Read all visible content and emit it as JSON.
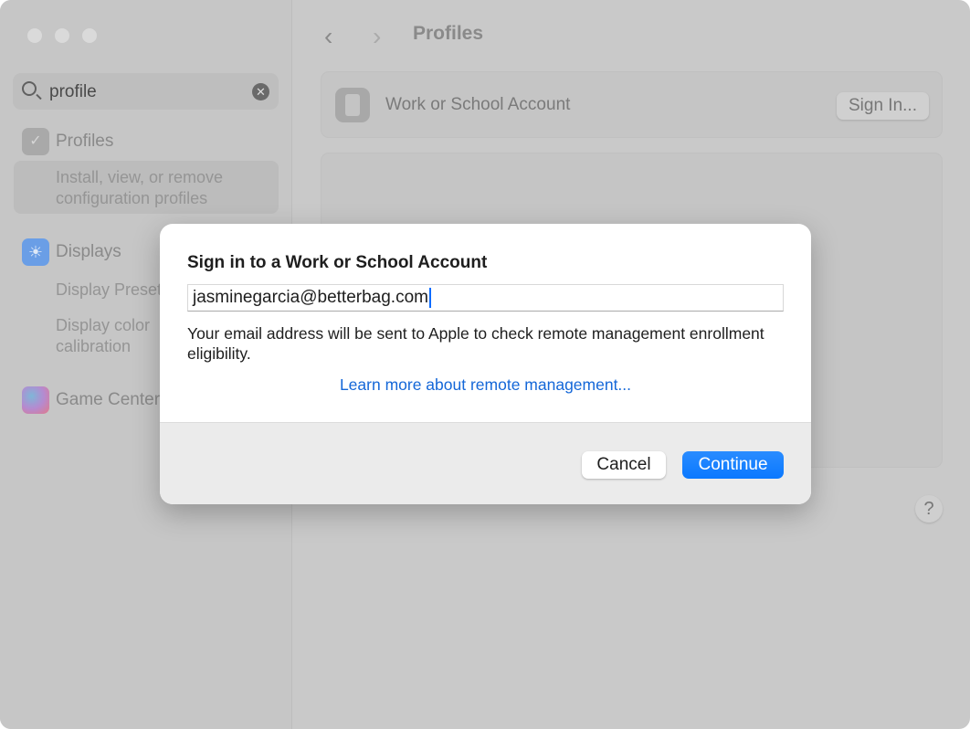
{
  "sidebar": {
    "search": {
      "value": "profile",
      "clear_icon": "xmark-circle-icon"
    },
    "profiles": {
      "title": "Profiles",
      "sub": "Install, view, or remove configuration profiles",
      "icon": "checkmark-seal-icon"
    },
    "displays": {
      "title": "Displays",
      "items": [
        "Display Presets",
        "Display color calibration"
      ],
      "icon": "sun-icon",
      "color": "#6a9ee6"
    },
    "game_center": {
      "title": "Game Center",
      "icon": "game-center-icon"
    }
  },
  "header": {
    "back": "‹",
    "forward": "›",
    "title": "Profiles"
  },
  "account": {
    "label": "Work or School Account",
    "button": "Sign In..."
  },
  "help": "?",
  "dialog": {
    "title": "Sign in to a Work or School Account",
    "email": "jasminegarcia@betterbag.com",
    "info": "Your email address will be sent to Apple to check remote management enrollment eligibility.",
    "link": "Learn more about remote management...",
    "cancel": "Cancel",
    "continue": "Continue",
    "accent": "#0a78ff"
  }
}
